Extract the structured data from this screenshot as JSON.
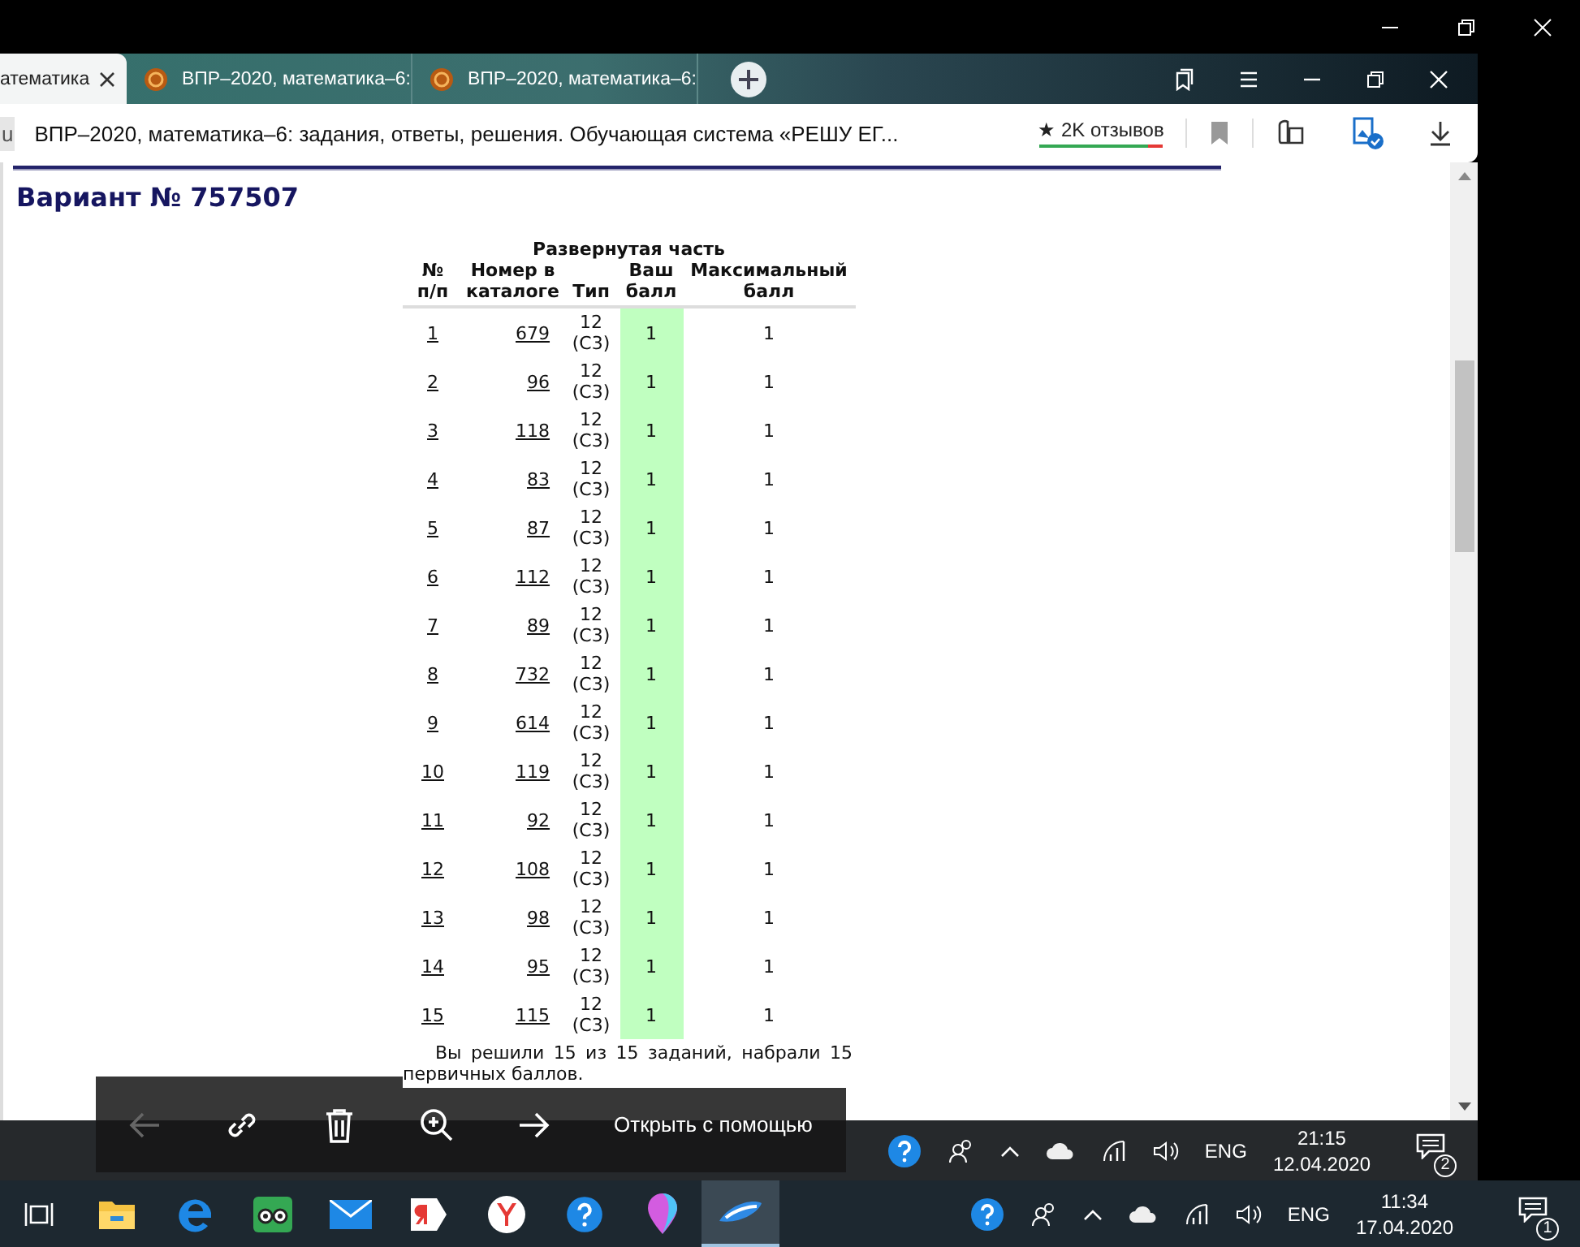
{
  "viewer": {
    "toolbar": [
      {
        "kind": "back",
        "disabled": true
      },
      {
        "kind": "link",
        "disabled": false
      },
      {
        "kind": "delete",
        "disabled": false
      },
      {
        "kind": "zoom_in",
        "disabled": false
      },
      {
        "kind": "forward",
        "disabled": false
      }
    ],
    "open_with": "Открыть с помощью"
  },
  "browser": {
    "tabs": [
      {
        "title": "атематика",
        "selected": true
      },
      {
        "title": "ВПР–2020, математика–6:",
        "selected": false
      },
      {
        "title": "ВПР–2020, математика–6:",
        "selected": false
      }
    ],
    "address_bar": {
      "domain": "u",
      "title": "ВПР–2020, математика–6: задания, ответы, решения. Обучающая система «РЕШУ ЕГ...",
      "reviews": "★ 2K отзывов",
      "rating": {
        "level": 0.88
      }
    }
  },
  "page": {
    "heading": "Вариант № 757507",
    "table": {
      "caption": "Развернутая часть",
      "columns": [
        "№\nп/п",
        "Номер в\nкаталоге",
        "Тип",
        "Ваш\nбалл",
        "Максимальный\nбалл"
      ],
      "rows": [
        {
          "cells": [
            "1",
            "679",
            "12 (С3)",
            "1",
            "1"
          ],
          "correct": true
        },
        {
          "cells": [
            "2",
            "96",
            "12 (С3)",
            "1",
            "1"
          ],
          "correct": true
        },
        {
          "cells": [
            "3",
            "118",
            "12 (С3)",
            "1",
            "1"
          ],
          "correct": true
        },
        {
          "cells": [
            "4",
            "83",
            "12 (С3)",
            "1",
            "1"
          ],
          "correct": true
        },
        {
          "cells": [
            "5",
            "87",
            "12 (С3)",
            "1",
            "1"
          ],
          "correct": true
        },
        {
          "cells": [
            "6",
            "112",
            "12 (С3)",
            "1",
            "1"
          ],
          "correct": true
        },
        {
          "cells": [
            "7",
            "89",
            "12 (С3)",
            "1",
            "1"
          ],
          "correct": true
        },
        {
          "cells": [
            "8",
            "732",
            "12 (С3)",
            "1",
            "1"
          ],
          "correct": true
        },
        {
          "cells": [
            "9",
            "614",
            "12 (С3)",
            "1",
            "1"
          ],
          "correct": true
        },
        {
          "cells": [
            "10",
            "119",
            "12 (С3)",
            "1",
            "1"
          ],
          "correct": true
        },
        {
          "cells": [
            "11",
            "92",
            "12 (С3)",
            "1",
            "1"
          ],
          "correct": true
        },
        {
          "cells": [
            "12",
            "108",
            "12 (С3)",
            "1",
            "1"
          ],
          "correct": true
        },
        {
          "cells": [
            "13",
            "98",
            "12 (С3)",
            "1",
            "1"
          ],
          "correct": true
        },
        {
          "cells": [
            "14",
            "95",
            "12 (С3)",
            "1",
            "1"
          ],
          "correct": true
        },
        {
          "cells": [
            "15",
            "115",
            "12 (С3)",
            "1",
            "1"
          ],
          "correct": true
        }
      ]
    },
    "summary": "Вы решили 15 из 15 заданий, набрали 15 первичных баллов."
  },
  "inner_taskbar": {
    "lang": "ENG",
    "time": "21:15",
    "date": "12.04.2020",
    "notifications": "2"
  },
  "taskbar": {
    "apps": [
      {
        "kind": "task_view",
        "active": false
      },
      {
        "kind": "folder",
        "active": false
      },
      {
        "kind": "browser_e",
        "active": false
      },
      {
        "kind": "owl",
        "active": false
      },
      {
        "kind": "mail",
        "active": false
      },
      {
        "kind": "ya",
        "active": false
      },
      {
        "kind": "browser_y",
        "active": false
      },
      {
        "kind": "help",
        "active": false
      },
      {
        "kind": "balloon",
        "active": false
      },
      {
        "kind": "photos",
        "active": true
      }
    ],
    "lang": "ENG",
    "time": "11:34",
    "date": "17.04.2020",
    "notifications": "1"
  }
}
